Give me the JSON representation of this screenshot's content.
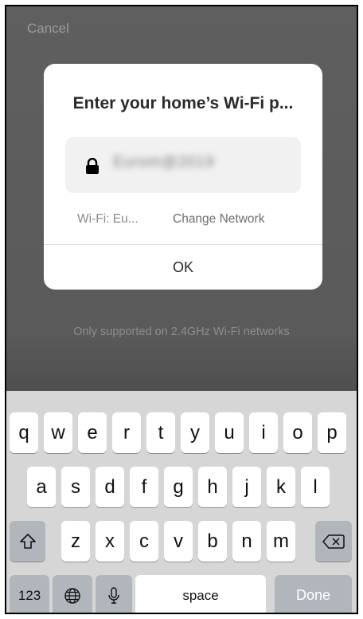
{
  "screen": {
    "cancel_label": "Cancel",
    "supported_hint": "Only supported on 2.4GHz Wi-Fi networks"
  },
  "dialog": {
    "title": "Enter your home’s Wi-Fi p...",
    "password_value": "Eurom@2019",
    "wifi_label": "Wi-Fi: Eu...",
    "change_network_label": "Change Network",
    "ok_label": "OK"
  },
  "keyboard": {
    "row1": [
      "q",
      "w",
      "e",
      "r",
      "t",
      "y",
      "u",
      "i",
      "o",
      "p"
    ],
    "row2": [
      "a",
      "s",
      "d",
      "f",
      "g",
      "h",
      "j",
      "k",
      "l"
    ],
    "row3": [
      "z",
      "x",
      "c",
      "v",
      "b",
      "n",
      "m"
    ],
    "numbers_label": "123",
    "space_label": "space",
    "done_label": "Done",
    "icons": {
      "shift": "shift-icon",
      "backspace": "backspace-icon",
      "globe": "globe-icon",
      "mic": "microphone-icon"
    }
  },
  "colors": {
    "backdrop": "#5a5a5a",
    "keyboard_bg": "#d6d6d6",
    "done_key": "#b1b6bd"
  }
}
